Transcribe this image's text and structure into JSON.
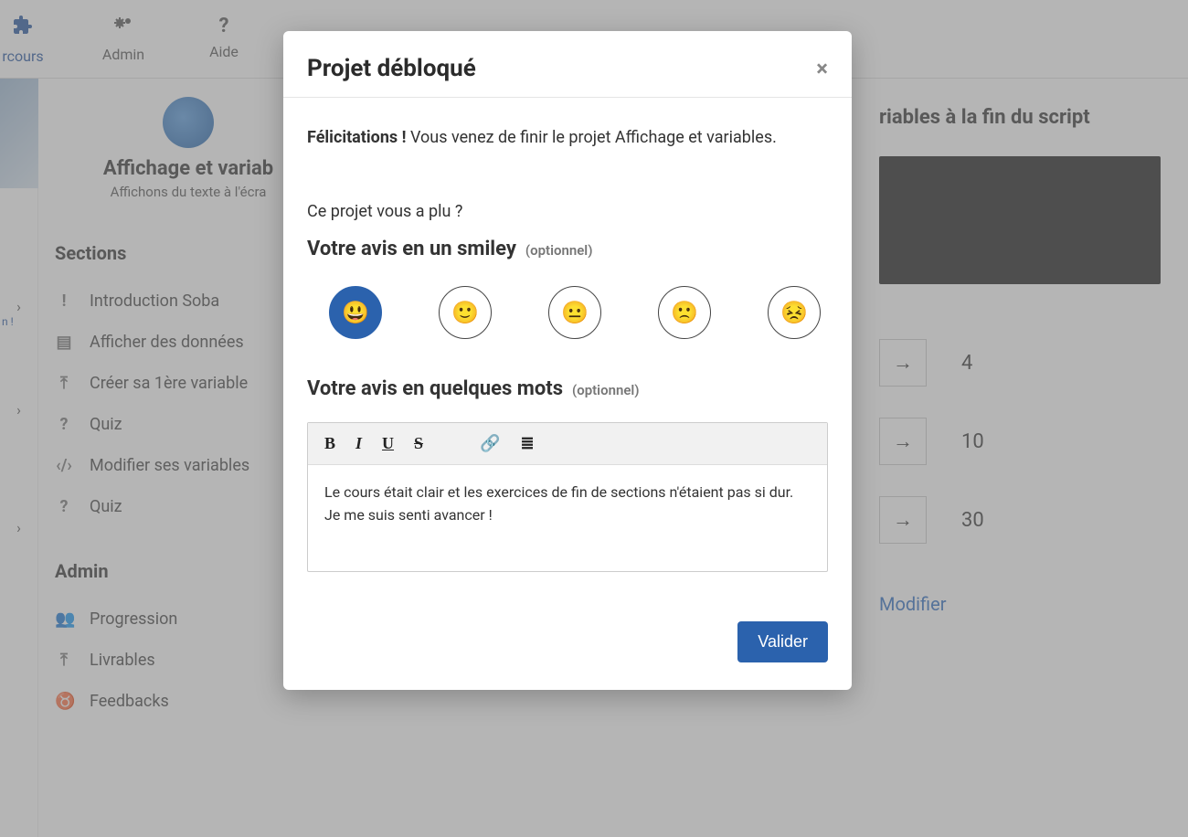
{
  "nav": {
    "parcours": "rcours",
    "admin": "Admin",
    "aide": "Aide"
  },
  "course": {
    "title": "Affichage et variab",
    "subtitle": "Affichons du texte à l'écra"
  },
  "sidebar": {
    "sections_h": "Sections",
    "items": [
      {
        "label": "Introduction Soba"
      },
      {
        "label": "Afficher des données"
      },
      {
        "label": "Créer sa 1ère variable"
      },
      {
        "label": "Quiz"
      },
      {
        "label": "Modifier ses variables"
      },
      {
        "label": "Quiz"
      }
    ],
    "admin_h": "Admin",
    "admin_items": [
      {
        "label": "Progression"
      },
      {
        "label": "Livrables"
      },
      {
        "label": "Feedbacks"
      }
    ]
  },
  "strip": {
    "text1": "n !"
  },
  "main": {
    "title_fragment": "riables à la fin du script",
    "results": [
      "4",
      "10",
      "30"
    ],
    "modifier": "Modifier"
  },
  "modal": {
    "title": "Projet débloqué",
    "congrats_bold": "Félicitations !",
    "congrats_rest": " Vous venez de finir le projet Affichage et variables.",
    "liked_q": "Ce projet vous a plu ?",
    "smiley_h": "Votre avis en un smiley",
    "optional": "(optionnel)",
    "words_h": "Votre avis en quelques mots",
    "smileys": [
      "😃",
      "🙂",
      "😐",
      "🙁",
      "😣"
    ],
    "toolbar": {
      "bold": "B",
      "italic": "I",
      "underline": "U",
      "strike": "S",
      "link": "🔗",
      "list": "≣"
    },
    "editor_text": "Le cours était clair et les exercices de fin de sections n'étaient pas si dur. Je me suis senti avancer !",
    "validate": "Valider"
  }
}
